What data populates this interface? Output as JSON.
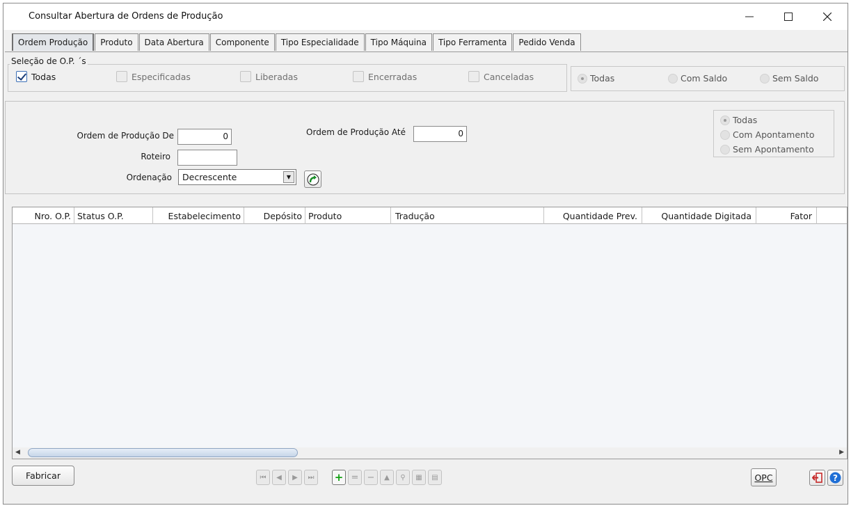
{
  "window": {
    "title": "Consultar Abertura de Ordens de Produção"
  },
  "tabs": [
    {
      "label": "Ordem Produção",
      "active": true
    },
    {
      "label": "Produto"
    },
    {
      "label": "Data Abertura"
    },
    {
      "label": "Componente"
    },
    {
      "label": "Tipo Especialidade"
    },
    {
      "label": "Tipo Máquina"
    },
    {
      "label": "Tipo Ferramenta"
    },
    {
      "label": "Pedido Venda"
    }
  ],
  "selection": {
    "group_label": "Seleção de O.P. ´s",
    "checkboxes": [
      {
        "label": "Todas",
        "checked": true
      },
      {
        "label": "Especificadas",
        "checked": false
      },
      {
        "label": "Liberadas",
        "checked": false
      },
      {
        "label": "Encerradas",
        "checked": false
      },
      {
        "label": "Canceladas",
        "checked": false
      }
    ],
    "saldo_radios": [
      {
        "label": "Todas",
        "selected": true
      },
      {
        "label": "Com Saldo",
        "selected": false
      },
      {
        "label": "Sem Saldo",
        "selected": false
      }
    ]
  },
  "filters": {
    "op_de_label": "Ordem de Produção De",
    "op_de_value": "0",
    "op_ate_label": "Ordem de Produção Até",
    "op_ate_value": "0",
    "roteiro_label": "Roteiro",
    "roteiro_value": "",
    "ordenacao_label": "Ordenação",
    "ordenacao_value": "Decrescente",
    "apontamento_radios": [
      {
        "label": "Todas",
        "selected": true
      },
      {
        "label": "Com Apontamento",
        "selected": false
      },
      {
        "label": "Sem Apontamento",
        "selected": false
      }
    ]
  },
  "grid": {
    "columns": [
      "Nro. O.P.",
      "Status O.P.",
      "Estabelecimento",
      "Depósito",
      "Produto",
      "Tradução",
      "Quantidade Prev.",
      "Quantidade Digitada",
      "Fator"
    ]
  },
  "footer": {
    "fabricar_label": "Fabricar",
    "opc_label": "OPC",
    "nav_icons": [
      "first-icon",
      "prev-icon",
      "next-icon",
      "last-icon",
      "add-icon",
      "equal-icon",
      "remove-icon",
      "up-icon",
      "search-icon",
      "table-icon",
      "export-icon"
    ]
  },
  "colors": {
    "window_bg": "#f0f0f0",
    "add_green": "#12a012",
    "help_blue": "#1f6fd6",
    "exit_red": "#c62828"
  }
}
